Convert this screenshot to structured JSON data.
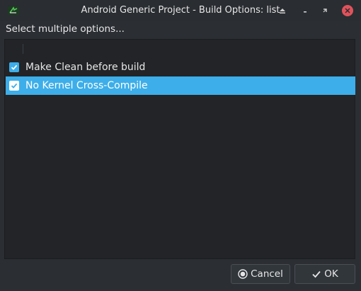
{
  "window": {
    "title": "Android Generic Project - Build Options: list"
  },
  "prompt": "Select multiple options...",
  "options": [
    {
      "label": "Make Clean before build",
      "checked": true,
      "selected": false
    },
    {
      "label": "No Kernel Cross-Compile",
      "checked": true,
      "selected": true
    }
  ],
  "buttons": {
    "cancel": "Cancel",
    "ok": "OK"
  },
  "icons": {
    "app": "android-app-icon",
    "shade": "shade-icon",
    "minimize": "minimize-icon",
    "maximize": "maximize-icon",
    "close": "close-icon",
    "cancel": "cancel-icon",
    "ok": "checkmark-icon"
  },
  "colors": {
    "accent": "#3daee9",
    "close": "#e0525b",
    "background": "#2b2e33",
    "list_background": "#222427"
  }
}
